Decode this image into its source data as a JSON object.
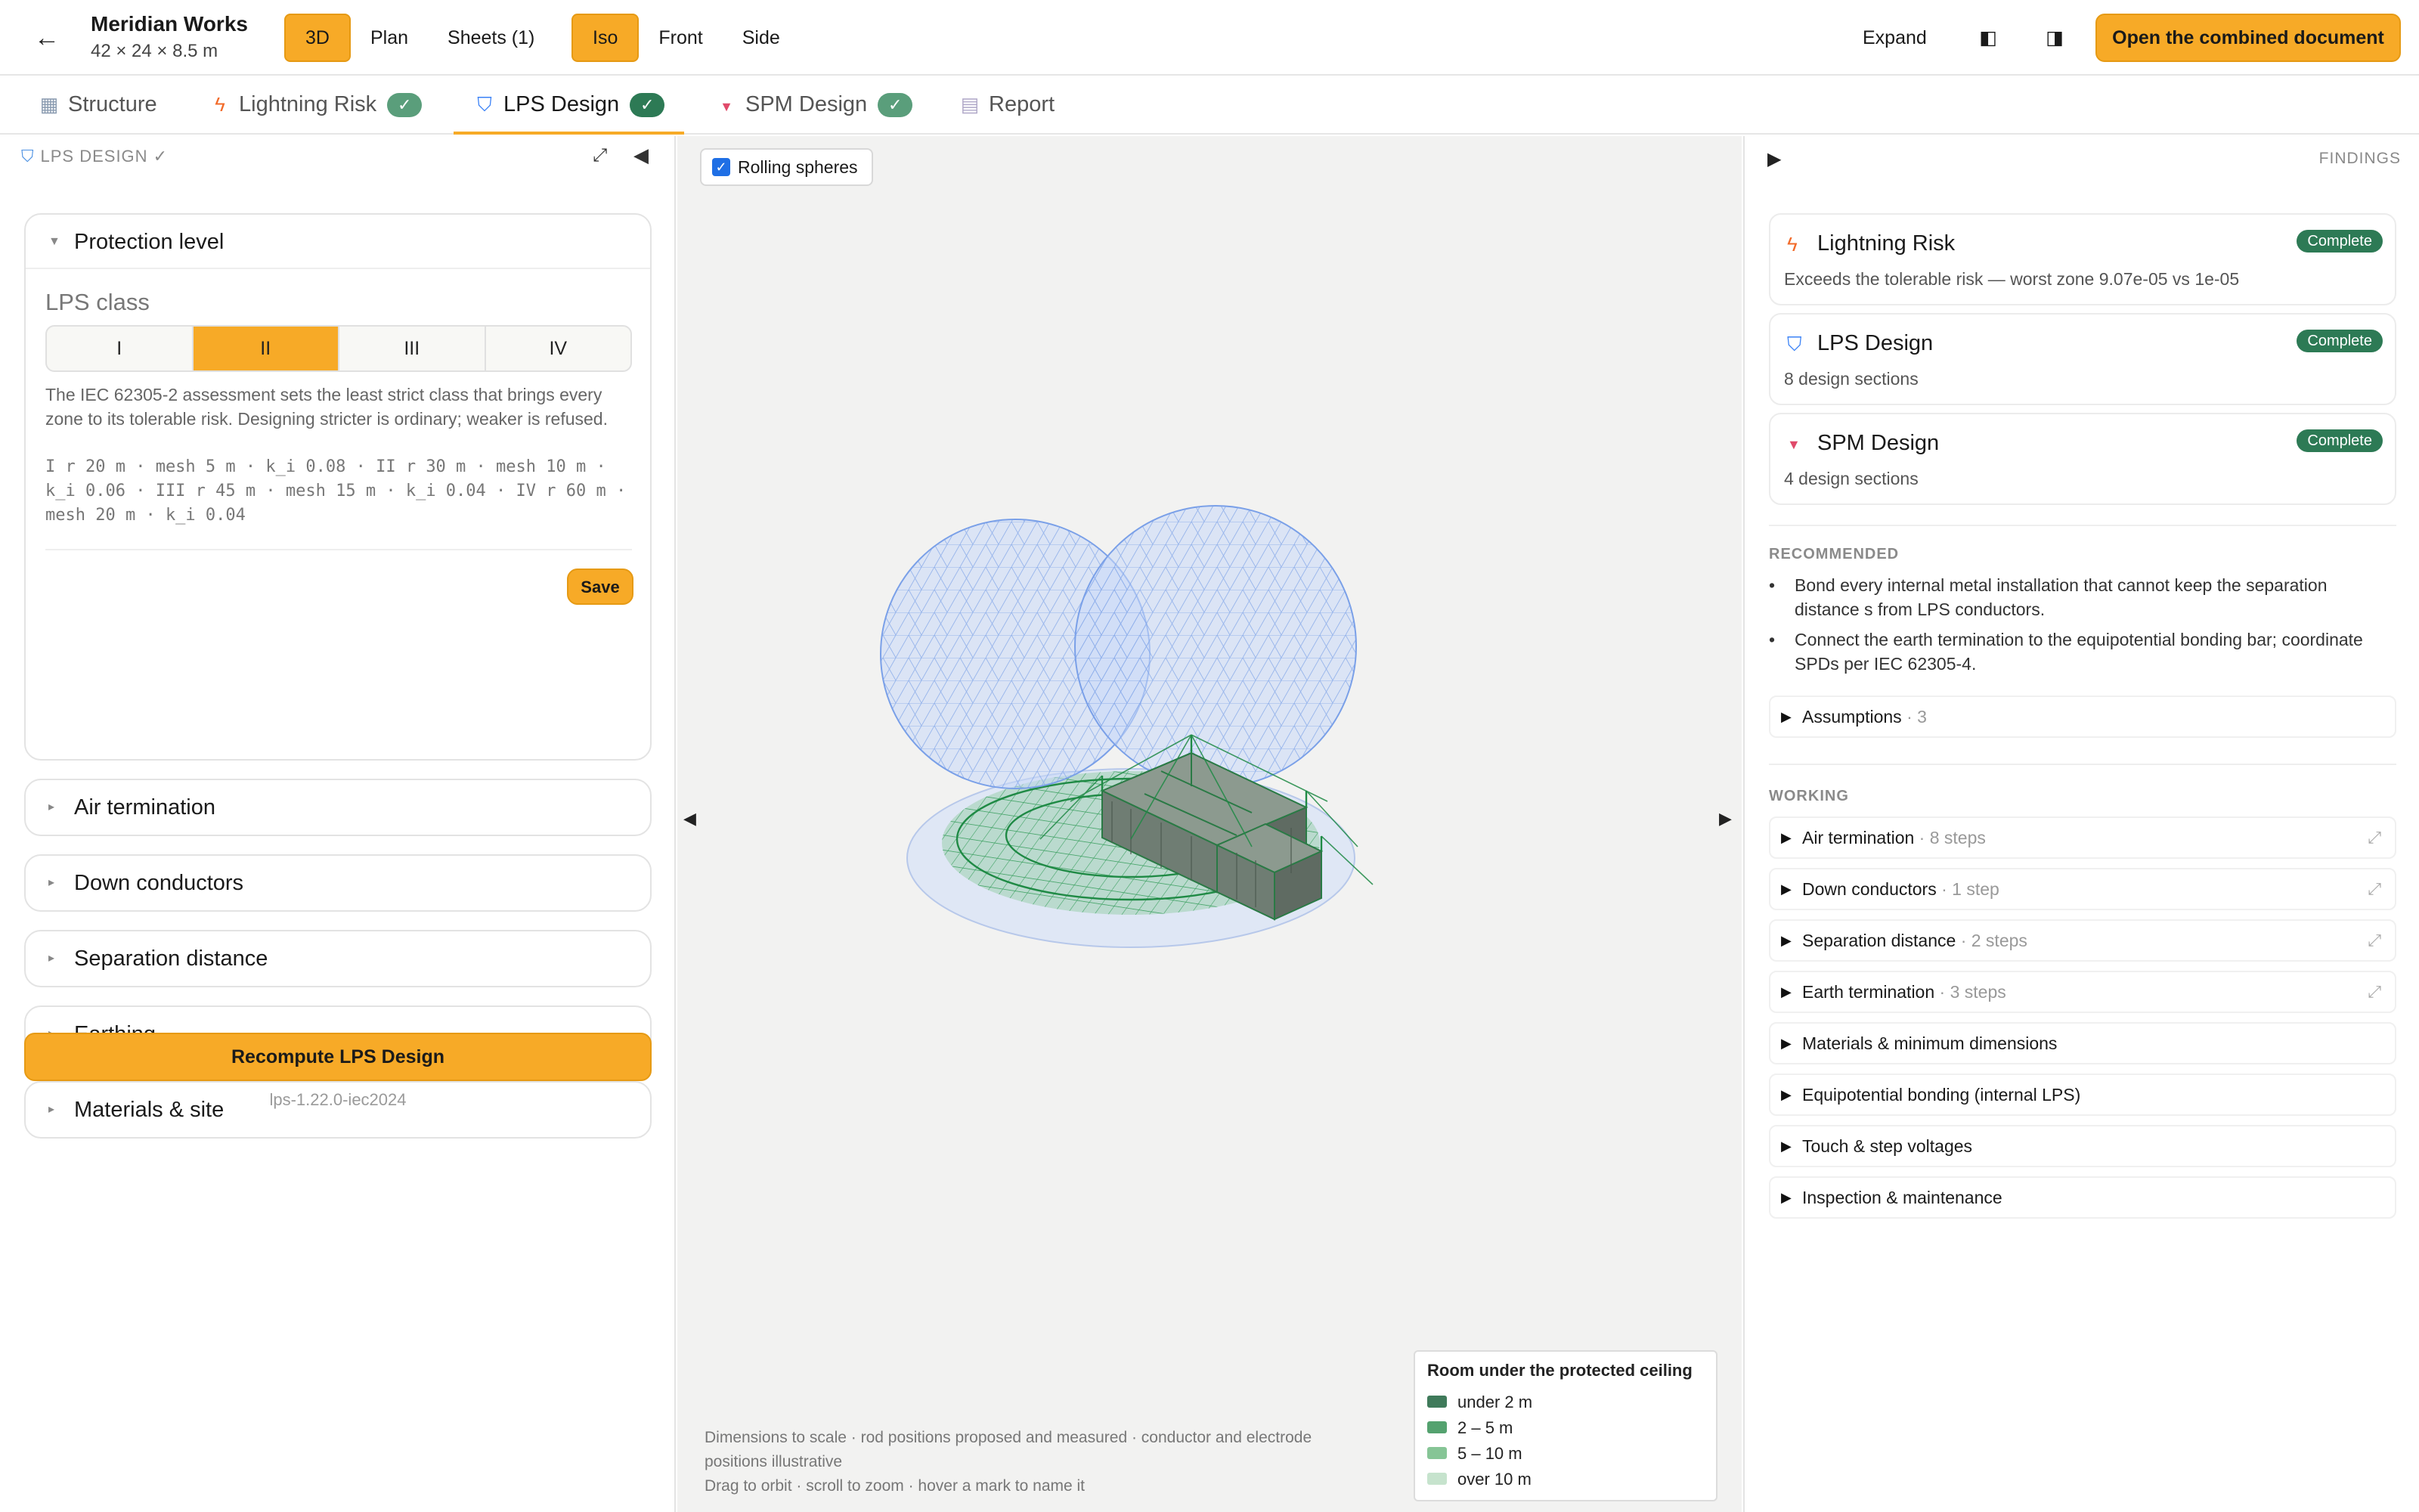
{
  "header": {
    "back_icon": "arrow-left-icon",
    "title": "Meridian Works",
    "subtitle": "42 × 24 × 8.5 m",
    "view_modes": [
      "3D",
      "Plan",
      "Sheets (1)"
    ],
    "active_view_mode": "3D",
    "projections": [
      "Iso",
      "Front",
      "Side"
    ],
    "active_projection": "Iso",
    "expand_label": "Expand",
    "panel_left_icon": "◧",
    "panel_right_icon": "◨",
    "open_document_label": "Open the combined document",
    "accent_color": "#f7aa27"
  },
  "tabs": [
    {
      "label": "Structure",
      "icon": "▦",
      "icon_name": "building-icon",
      "checked": false
    },
    {
      "label": "Lightning Risk",
      "icon": "ϟ",
      "icon_name": "lightning-icon",
      "checked": true
    },
    {
      "label": "LPS Design",
      "icon": "⛉",
      "icon_name": "shield-icon",
      "checked": true,
      "active": true
    },
    {
      "label": "SPM Design",
      "icon": "▼",
      "icon_name": "spm-icon",
      "checked": true
    },
    {
      "label": "Report",
      "icon": "▤",
      "icon_name": "report-icon",
      "checked": false
    }
  ],
  "check_mark": "✓",
  "left_panel": {
    "heading": "LPS DESIGN ✓",
    "expand_icon": "⤢",
    "collapse_icon": "◀",
    "protection_level": {
      "title": "Protection level",
      "class_label": "LPS class",
      "classes": [
        "I",
        "II",
        "III",
        "IV"
      ],
      "selected_class": "II",
      "description": "The IEC 62305-2 assessment sets the least strict class that brings every zone to its tolerable risk. Designing stricter is ordinary; weaker is refused.",
      "parameters": "I r 20 m · mesh 5 m · k_i 0.08 · II r 30 m · mesh 10 m · k_i 0.06 · III r 45 m · mesh 15 m · k_i 0.04 · IV r 60 m · mesh 20 m · k_i 0.04",
      "save_label": "Save"
    },
    "sections": [
      "Air termination",
      "Down conductors",
      "Separation distance",
      "Earthing",
      "Materials & site"
    ],
    "recompute_label": "Recompute LPS Design",
    "version": "lps-1.22.0-iec2024"
  },
  "viewport": {
    "rolling_spheres_label": "Rolling spheres",
    "rolling_spheres_checked": true,
    "notes": [
      "Dimensions to scale · rod positions proposed and measured · conductor and electrode positions illustrative",
      "Drag to orbit · scroll to zoom · hover a mark to name it"
    ],
    "legend": {
      "title": "Room under the protected ceiling",
      "items": [
        {
          "label": "under 2 m",
          "color": "#3f7a5a"
        },
        {
          "label": "2 – 5 m",
          "color": "#54a26f"
        },
        {
          "label": "5 – 10 m",
          "color": "#86c596"
        },
        {
          "label": "over 10 m",
          "color": "#c6e3cd"
        }
      ]
    }
  },
  "right_panel": {
    "toggle_icon": "▶",
    "heading": "FINDINGS",
    "findings": [
      {
        "icon": "ϟ",
        "icon_name": "lightning-icon",
        "icon_color": "#f26b2a",
        "title": "Lightning Risk",
        "status": "Complete",
        "description": "Exceeds the tolerable risk — worst zone 9.07e-05 vs 1e-05"
      },
      {
        "icon": "⛉",
        "icon_name": "shield-icon",
        "icon_color": "#3b82f6",
        "title": "LPS Design",
        "status": "Complete",
        "description": "8 design sections"
      },
      {
        "icon": "▼",
        "icon_name": "spm-icon",
        "icon_color": "#e04a6a",
        "title": "SPM Design",
        "status": "Complete",
        "description": "4 design sections"
      }
    ],
    "recommended_label": "RECOMMENDED",
    "recommendations": [
      "Bond every internal metal installation that cannot keep the separation distance s from LPS conductors.",
      "Connect the earth termination to the equipotential bonding bar; coordinate SPDs per IEC 62305-4."
    ],
    "assumptions": {
      "label": "Assumptions",
      "meta": "· 3"
    },
    "working_label": "WORKING",
    "working": [
      {
        "label": "Air termination",
        "meta": "· 8 steps",
        "has_ext": true
      },
      {
        "label": "Down conductors",
        "meta": "· 1 step",
        "has_ext": true
      },
      {
        "label": "Separation distance",
        "meta": "· 2 steps",
        "has_ext": true
      },
      {
        "label": "Earth termination",
        "meta": "· 3 steps",
        "has_ext": true
      },
      {
        "label": "Materials & minimum dimensions",
        "meta": "",
        "has_ext": false
      },
      {
        "label": "Equipotential bonding (internal LPS)",
        "meta": "",
        "has_ext": false
      },
      {
        "label": "Touch & step voltages",
        "meta": "",
        "has_ext": false
      },
      {
        "label": "Inspection & maintenance",
        "meta": "",
        "has_ext": false
      }
    ],
    "ext_icon": "⤢"
  }
}
